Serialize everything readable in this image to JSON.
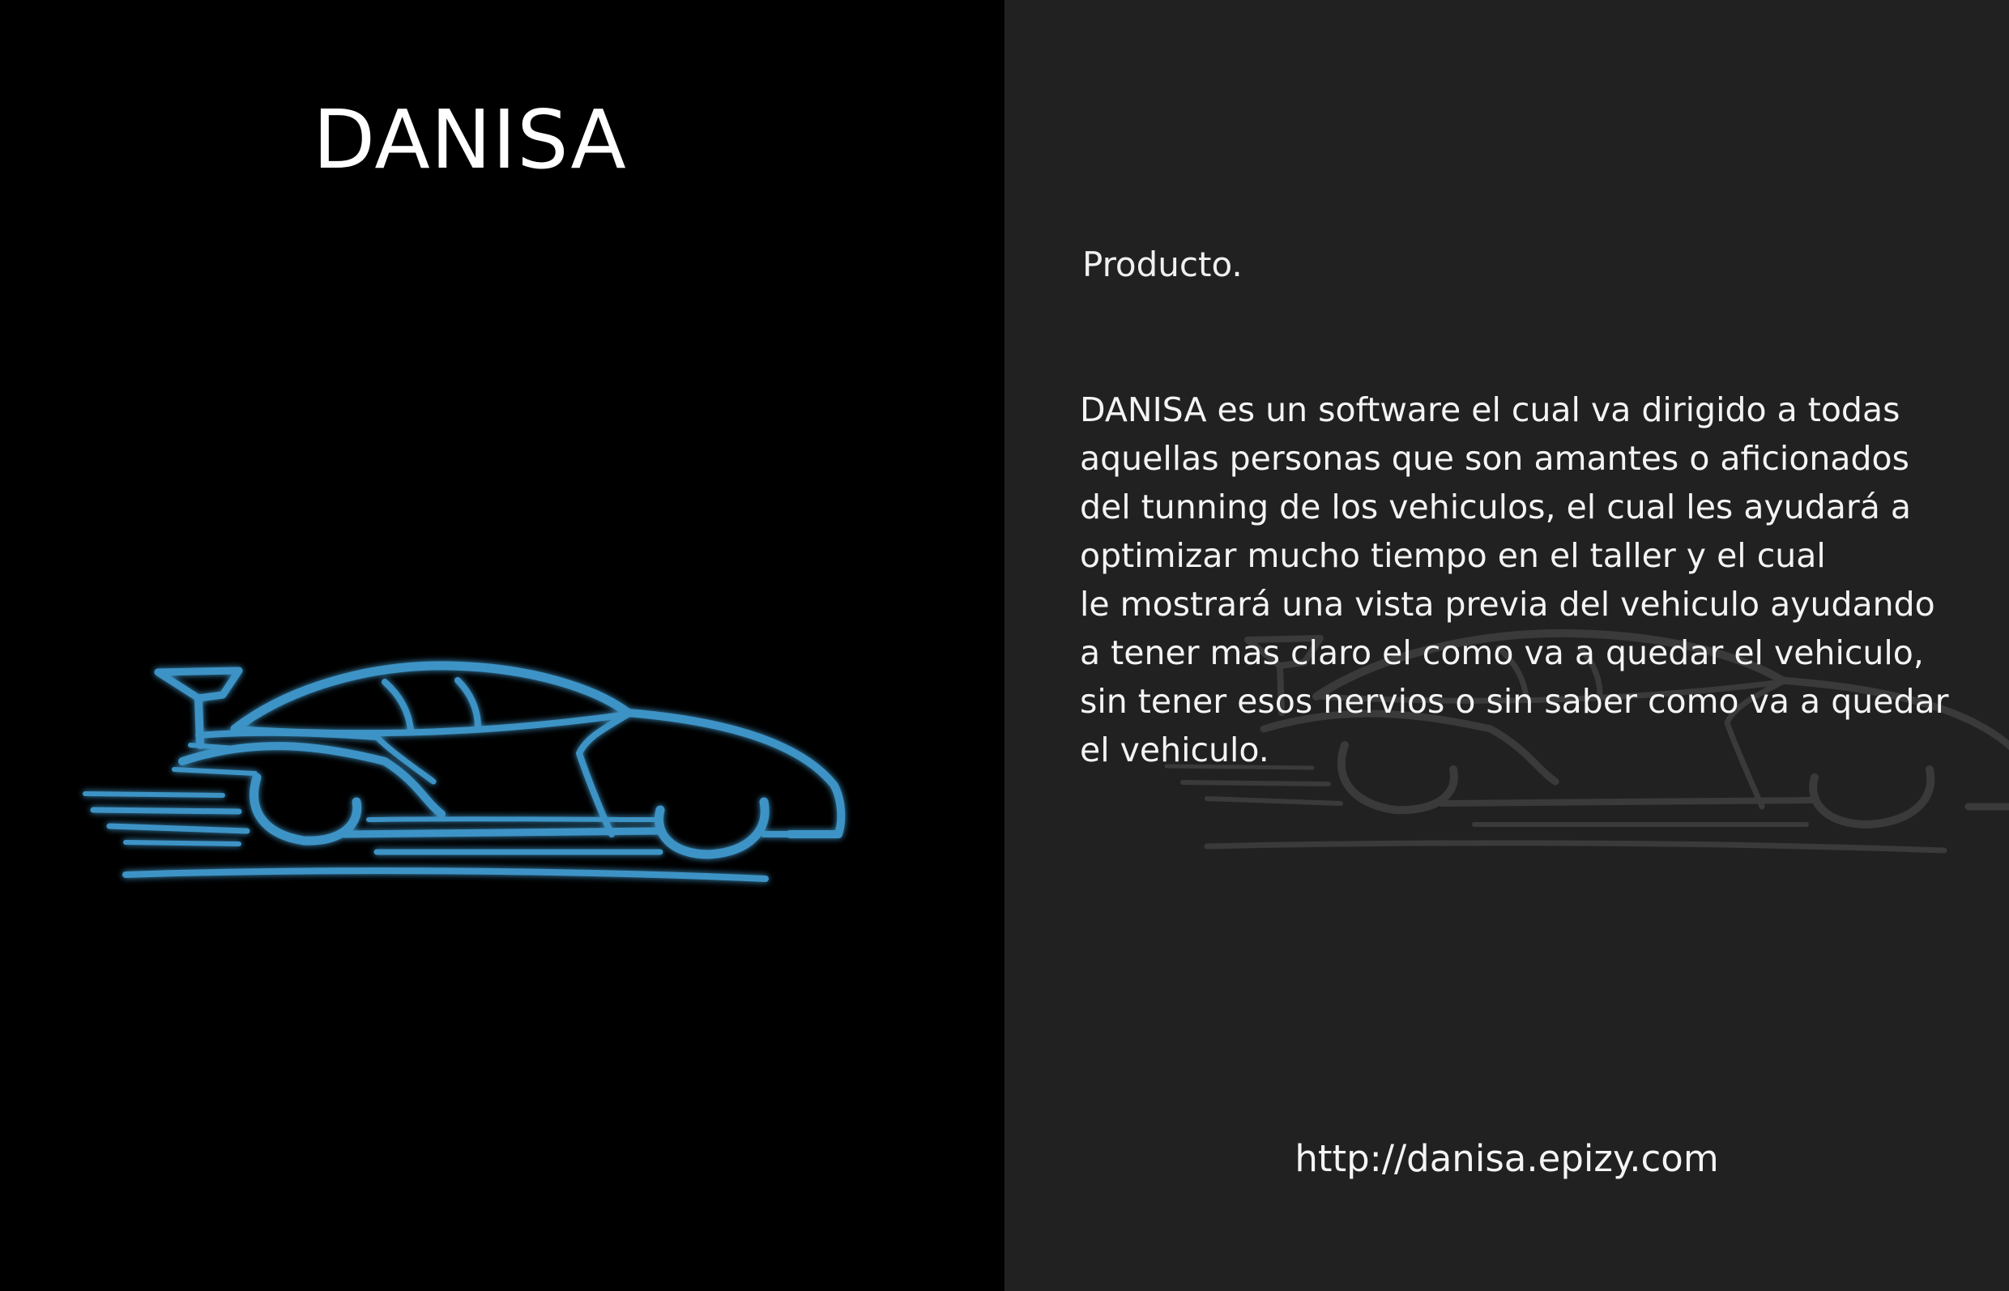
{
  "left_panel": {
    "title": "DANISA",
    "logo_icon": "sports-car-outline-icon",
    "logo_color": "#3d93c5"
  },
  "right_panel": {
    "section_label": "Producto.",
    "description": "DANISA es un software el cual va dirigido a todas\naquellas personas  que son amantes o aficionados\ndel tunning de los vehiculos, el cual les ayudará a\noptimizar mucho tiempo en el taller y el cual\nle mostrará una vista previa del vehiculo ayudando\na tener mas claro el como va a quedar el vehiculo,\nsin tener esos nervios o sin saber como va a quedar\nel vehiculo.",
    "website": "http://danisa.epizy.com",
    "watermark_icon": "sports-car-watermark-icon"
  },
  "colors": {
    "left_background": "#000000",
    "right_background": "#212121",
    "text": "#f2f2f2",
    "accent": "#3d93c5"
  }
}
